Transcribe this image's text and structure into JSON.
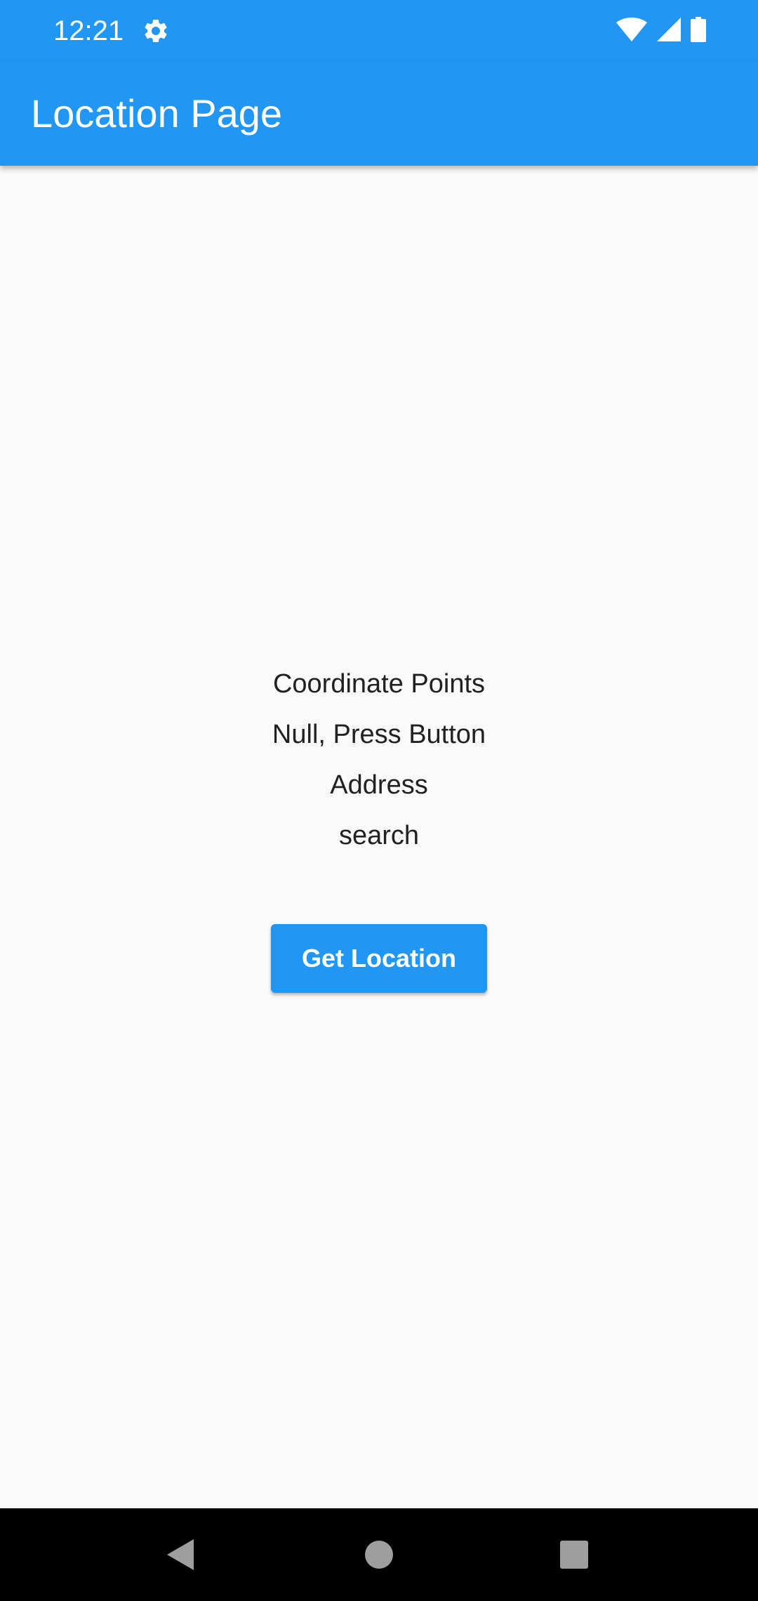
{
  "status_bar": {
    "time": "12:21",
    "icons": [
      "gear-icon",
      "wifi-icon",
      "cell-signal-icon",
      "battery-icon"
    ],
    "background": "#2196f3"
  },
  "app_bar": {
    "title": "Location Page",
    "background": "#2196f3"
  },
  "main": {
    "lines": [
      "Coordinate Points",
      "Null, Press Button",
      "Address",
      "search"
    ],
    "button_label": "Get Location",
    "button_color": "#2196f3"
  },
  "nav_bar": {
    "icons": [
      "back-icon",
      "home-icon",
      "recents-icon"
    ]
  }
}
